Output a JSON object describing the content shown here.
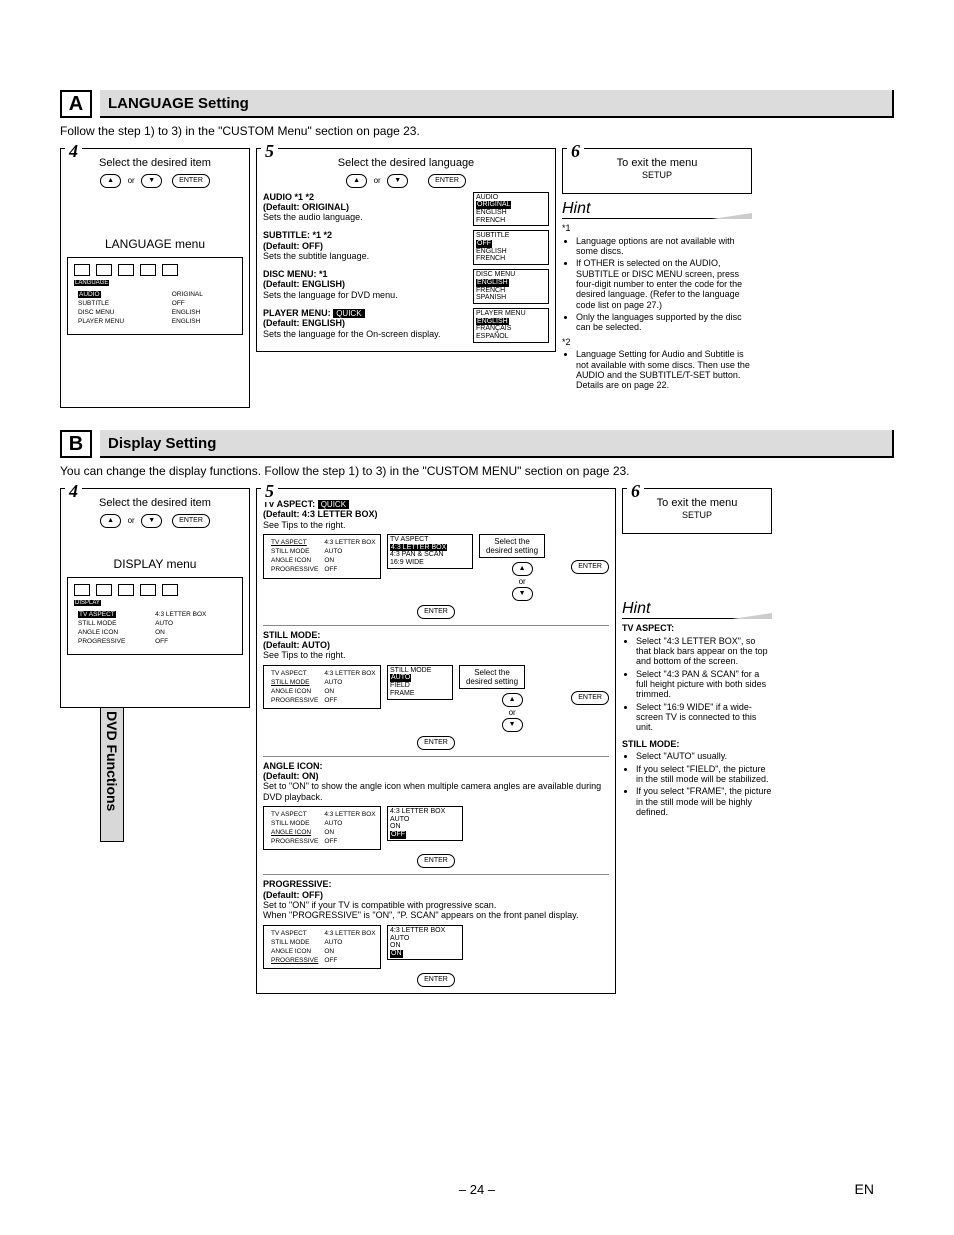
{
  "sideTab": "DVD Functions",
  "page": "– 24 –",
  "langCode": "EN",
  "A": {
    "letter": "A",
    "title": "LANGUAGE Setting",
    "intro": "Follow the step 1) to 3) in the \"CUSTOM Menu\" section on page 23.",
    "step4": {
      "num": "4",
      "title": "Select the desired item",
      "or": "or",
      "enter": "ENTER",
      "menuTitle": "LANGUAGE menu",
      "osd": {
        "tab": "LANGUAGE",
        "rows": [
          [
            "AUDIO",
            "ORIGINAL"
          ],
          [
            "SUBTITLE",
            "OFF"
          ],
          [
            "DISC MENU",
            "ENGLISH"
          ],
          [
            "PLAYER MENU",
            "ENGLISH"
          ]
        ]
      }
    },
    "step5": {
      "num": "5",
      "title": "Select the desired language",
      "or": "or",
      "enter": "ENTER",
      "items": [
        {
          "name": "AUDIO *1 *2",
          "def": "(Default: ORIGINAL)",
          "desc": "Sets the audio language.",
          "pop": {
            "hdr": "AUDIO",
            "sel": "ORIGINAL",
            "opts": [
              "ENGLISH",
              "FRENCH"
            ]
          }
        },
        {
          "name": "SUBTITLE: *1 *2",
          "def": "(Default: OFF)",
          "desc": "Sets the subtitle language.",
          "pop": {
            "hdr": "SUBTITLE",
            "sel": "OFF",
            "opts": [
              "ENGLISH",
              "FRENCH"
            ]
          }
        },
        {
          "name": "DISC MENU: *1",
          "def": "(Default: ENGLISH)",
          "desc": "Sets the language for DVD menu.",
          "pop": {
            "hdr": "DISC MENU",
            "sel": "ENGLISH",
            "opts": [
              "FRENCH",
              "SPANISH"
            ]
          }
        },
        {
          "name": "PLAYER MENU:",
          "quick": "QUICK",
          "def": "(Default: ENGLISH)",
          "desc": "Sets the language for the On-screen display.",
          "pop": {
            "hdr": "PLAYER MENU",
            "sel": "ENGLISH",
            "opts": [
              "FRANÇAIS",
              "ESPAÑOL"
            ]
          }
        }
      ]
    },
    "step6": {
      "num": "6",
      "title": "To exit the menu",
      "setup": "SETUP"
    },
    "hint": {
      "title": "Hint",
      "n1": "*1",
      "b1": [
        "Language options are not available with some discs.",
        "If OTHER is selected on the AUDIO, SUBTITLE or DISC MENU screen, press four-digit number to enter the code for the desired language. (Refer to the language code list on page 27.)",
        "Only the languages supported by the disc can be selected."
      ],
      "n2": "*2",
      "b2": [
        "Language Setting for Audio and Subtitle is not available with some discs. Then use the AUDIO and the SUBTITLE/T-SET button. Details are on page 22."
      ]
    }
  },
  "B": {
    "letter": "B",
    "title": "Display Setting",
    "intro": "You can change the display functions. Follow the step 1) to 3) in the \"CUSTOM MENU\" section on page 23.",
    "step4": {
      "num": "4",
      "title": "Select the desired item",
      "or": "or",
      "enter": "ENTER",
      "menuTitle": "DISPLAY menu",
      "osd": {
        "tab": "DISPLAY",
        "rows": [
          [
            "TV ASPECT",
            "4:3 LETTER BOX"
          ],
          [
            "STILL MODE",
            "AUTO"
          ],
          [
            "ANGLE ICON",
            "ON"
          ],
          [
            "PROGRESSIVE",
            "OFF"
          ]
        ]
      }
    },
    "step5": {
      "num": "5",
      "tv": {
        "name": "TV ASPECT:",
        "quick": "QUICK",
        "def": "(Default: 4:3 LETTER BOX)",
        "desc": "See Tips to the right.",
        "osdRows": [
          [
            "TV ASPECT",
            "4:3 LETTER BOX"
          ],
          [
            "STILL MODE",
            "AUTO"
          ],
          [
            "ANGLE ICON",
            "ON"
          ],
          [
            "PROGRESSIVE",
            "OFF"
          ]
        ],
        "hlRow": 0,
        "pop": {
          "hdr": "TV ASPECT",
          "sel": "4:3 LETTER BOX",
          "opts": [
            "4:3 PAN & SCAN",
            "16:9 WIDE"
          ]
        },
        "sel": "Select the desired setting",
        "or": "or",
        "enter": "ENTER"
      },
      "still": {
        "name": "STILL MODE:",
        "def": "(Default: AUTO)",
        "desc": "See Tips to the right.",
        "osdRows": [
          [
            "TV ASPECT",
            "4:3 LETTER BOX"
          ],
          [
            "STILL MODE",
            "AUTO"
          ],
          [
            "ANGLE ICON",
            "ON"
          ],
          [
            "PROGRESSIVE",
            "OFF"
          ]
        ],
        "hlRow": 1,
        "pop": {
          "hdr": "STILL MODE",
          "sel": "AUTO",
          "opts": [
            "FIELD",
            "FRAME"
          ]
        },
        "sel": "Select the desired setting",
        "or": "or",
        "enter": "ENTER"
      },
      "angle": {
        "name": "ANGLE ICON:",
        "def": "(Default: ON)",
        "desc": "Set to \"ON\" to show the angle icon when multiple camera angles are available during DVD playback.",
        "osdRows": [
          [
            "TV ASPECT",
            "4:3 LETTER BOX"
          ],
          [
            "STILL MODE",
            "AUTO"
          ],
          [
            "ANGLE ICON",
            "ON"
          ],
          [
            "PROGRESSIVE",
            "OFF"
          ]
        ],
        "hlRow": 2,
        "pop": {
          "hdr": "4:3 LETTER BOX",
          "plain": [
            "AUTO",
            "ON",
            "OFF"
          ],
          "selIdx": 2
        },
        "enter": "ENTER"
      },
      "prog": {
        "name": "PROGRESSIVE:",
        "def": "(Default: OFF)",
        "desc1": "Set to \"ON\" if your TV is compatible with progressive scan.",
        "desc2": "When \"PROGRESSIVE\" is \"ON\", \"P. SCAN\" appears on the front panel display.",
        "osdRows": [
          [
            "TV ASPECT",
            "4:3 LETTER BOX"
          ],
          [
            "STILL MODE",
            "AUTO"
          ],
          [
            "ANGLE ICON",
            "ON"
          ],
          [
            "PROGRESSIVE",
            "OFF"
          ]
        ],
        "hlRow": 3,
        "pop": {
          "hdr": "4:3 LETTER BOX",
          "plain": [
            "AUTO",
            "ON",
            "ON"
          ],
          "selIdx": 2
        },
        "enter": "ENTER"
      }
    },
    "step6": {
      "num": "6",
      "title": "To exit the menu",
      "setup": "SETUP"
    },
    "hint": {
      "title": "Hint",
      "tvHdr": "TV ASPECT:",
      "tv": [
        "Select \"4:3 LETTER BOX\", so that black bars appear on the top and bottom of the screen.",
        "Select \"4:3 PAN & SCAN\" for a full height picture with both sides trimmed.",
        "Select \"16:9 WIDE\" if a wide-screen TV is connected to this unit."
      ],
      "stHdr": "STILL MODE:",
      "st": [
        "Select \"AUTO\" usually.",
        "If you select \"FIELD\", the picture in the still mode will be stabilized.",
        "If you select \"FRAME\", the picture in the still mode will be highly defined."
      ]
    }
  }
}
